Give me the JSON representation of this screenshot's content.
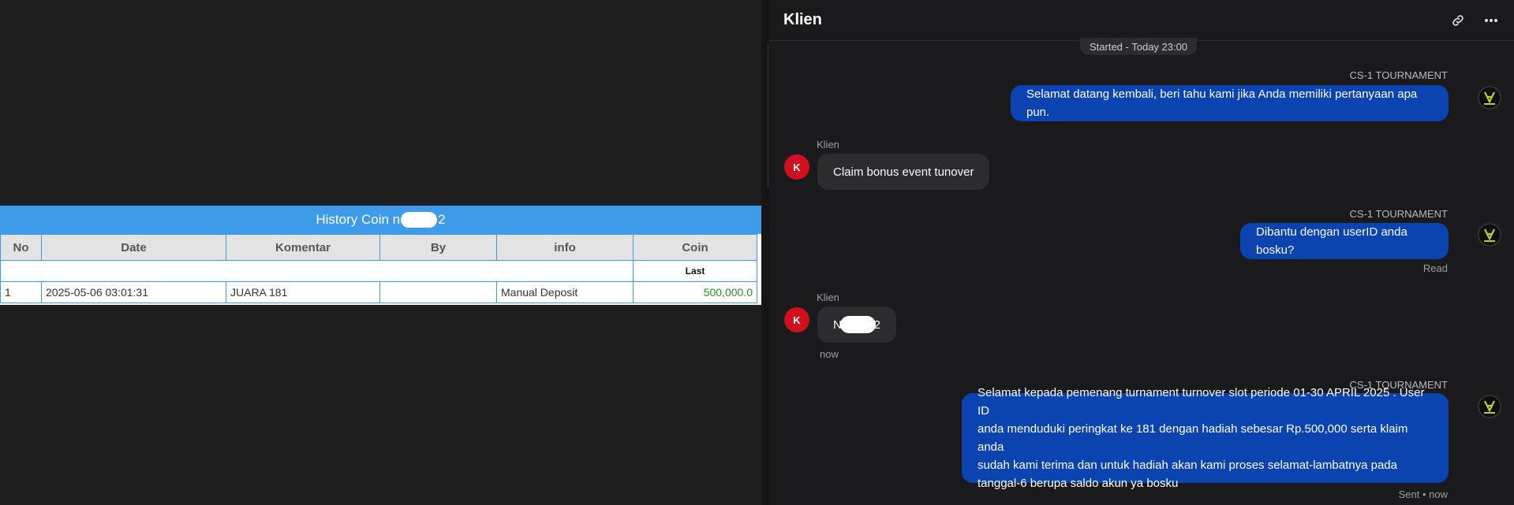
{
  "history": {
    "title_prefix": "History Coin n",
    "title_suffix": "2",
    "columns": [
      "No",
      "Date",
      "Komentar",
      "By",
      "info",
      "Coin"
    ],
    "sub_header_last": "Last",
    "rows": [
      {
        "no": "1",
        "date": "2025-05-06 03:01:31",
        "komentar": "JUARA 181",
        "by": "",
        "info": "Manual Deposit",
        "coin": "500,000.0"
      }
    ]
  },
  "chat": {
    "title": "Klien",
    "header_icons": [
      "link-icon",
      "more-icon"
    ],
    "started_label": "Started - Today 23:00",
    "messages": [
      {
        "sender": "CS-1 TOURNAMENT",
        "text": "Selamat datang kembali, beri tahu kami jika Anda memiliki pertanyaan apa pun."
      },
      {
        "sender": "Klien",
        "text": "Claim bonus event tunover"
      },
      {
        "sender": "CS-1 TOURNAMENT",
        "text": "Dibantu dengan userID anda bosku?",
        "status": "Read"
      },
      {
        "sender": "Klien",
        "text_prefix": "N",
        "text_suffix": "2",
        "time": "now"
      },
      {
        "sender": "CS-1 TOURNAMENT",
        "lines": [
          "Selamat kepada pemenang turnament turnover slot periode 01-30 APRIL 2025 . User ID",
          "anda menduduki peringkat ke 181 dengan hadiah sebesar Rp.500,000 serta klaim anda",
          "sudah kami terima dan untuk hadiah akan kami proses selamat-lambatnya pada",
          "tanggal-6 berupa saldo akun ya bosku"
        ],
        "status": "Sent • now"
      }
    ],
    "client_avatar_letter": "K"
  },
  "colors": {
    "agent_bubble": "#0b44b0",
    "client_bubble": "#2c2c2e",
    "table_header": "#3d9be9",
    "avatar": "#d0101e",
    "coin_green": "#2e8b2e"
  }
}
